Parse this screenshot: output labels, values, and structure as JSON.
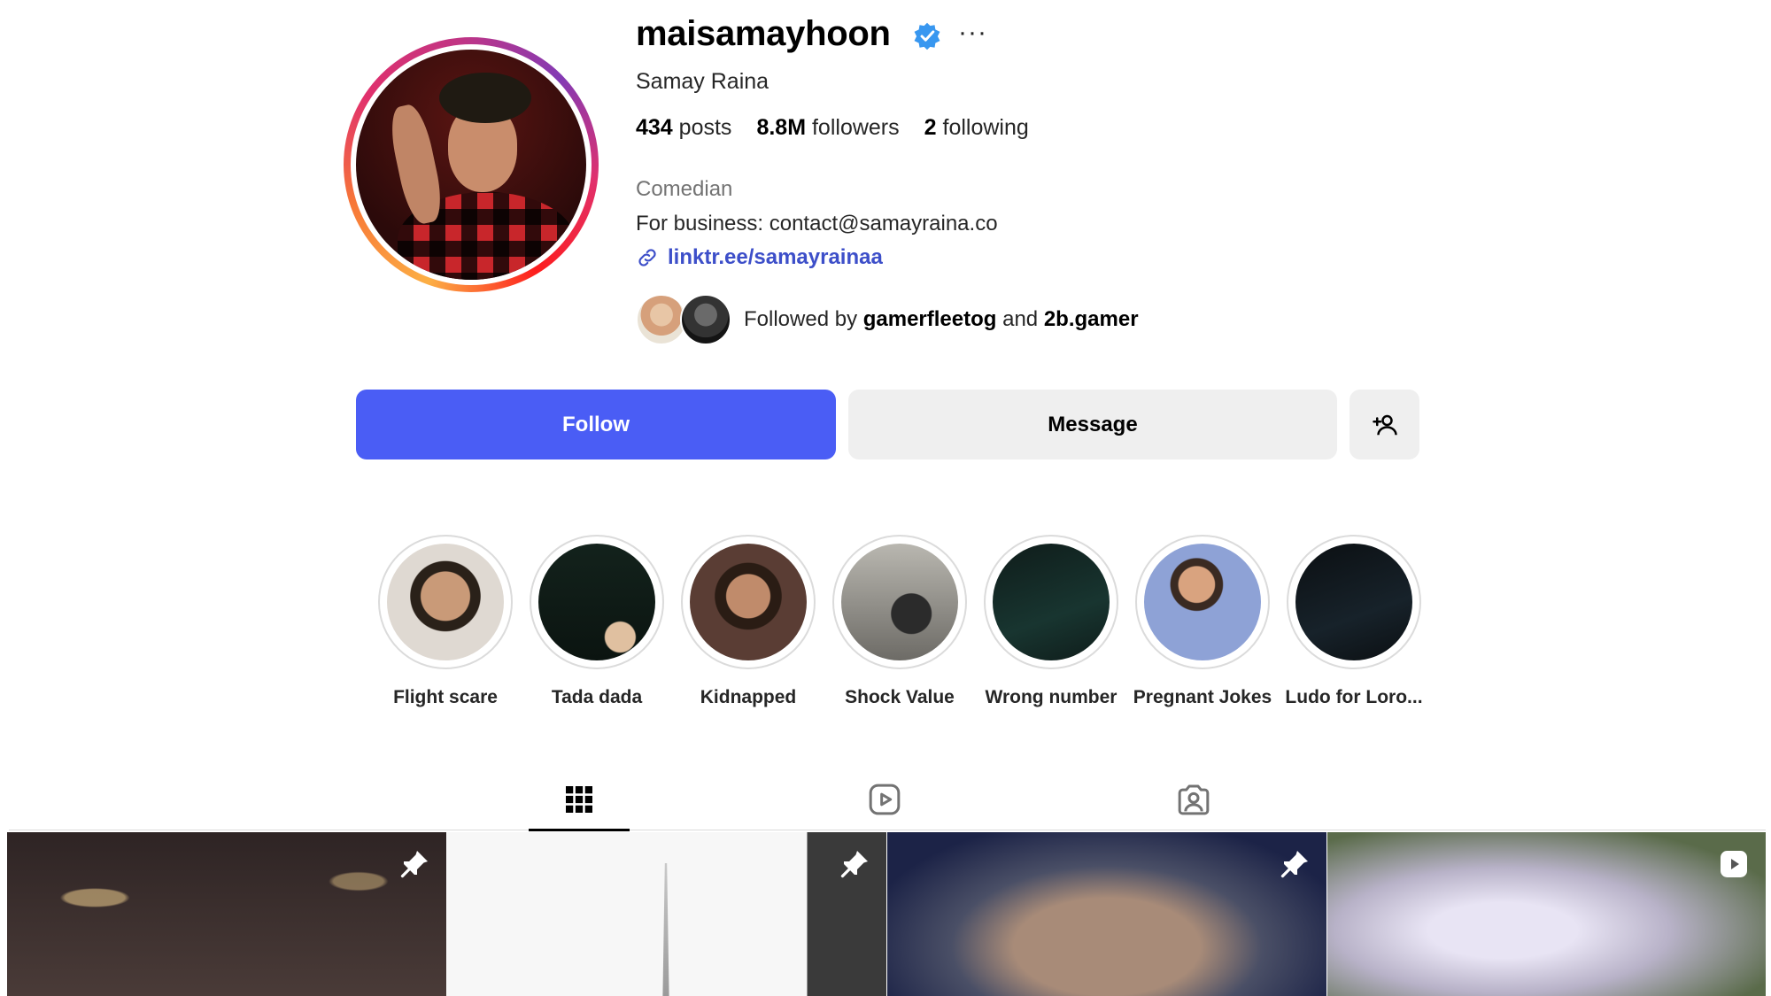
{
  "profile": {
    "username": "maisamayhoon",
    "full_name": "Samay Raina",
    "more_label": "···",
    "stats": {
      "posts_count": "434",
      "posts_label": "posts",
      "followers_count": "8.8M",
      "followers_label": "followers",
      "following_count": "2",
      "following_label": "following"
    },
    "category": "Comedian",
    "bio": "For business: contact@samayraina.co",
    "link": "linktr.ee/samayrainaa",
    "followed_by": {
      "prefix": "Followed by",
      "user1": "gamerfleetog",
      "joiner": "and",
      "user2": "2b.gamer"
    }
  },
  "actions": {
    "follow_label": "Follow",
    "message_label": "Message"
  },
  "highlights": [
    {
      "label": "Flight scare"
    },
    {
      "label": "Tada dada"
    },
    {
      "label": "Kidnapped"
    },
    {
      "label": "Shock Value"
    },
    {
      "label": "Wrong number"
    },
    {
      "label": "Pregnant Jokes"
    },
    {
      "label": "Ludo for Loro..."
    }
  ],
  "tabs": [
    {
      "icon": "grid-icon",
      "active": true
    },
    {
      "icon": "reels-icon",
      "active": false
    },
    {
      "icon": "tagged-icon",
      "active": false
    }
  ],
  "posts": [
    {
      "badge": "pin-icon"
    },
    {
      "badge": "pin-icon"
    },
    {
      "badge": "pin-icon"
    },
    {
      "badge": "reel-icon"
    }
  ],
  "colors": {
    "follow_button": "#4a5df5",
    "link": "#3d4fc9",
    "verified": "#3897f0"
  }
}
